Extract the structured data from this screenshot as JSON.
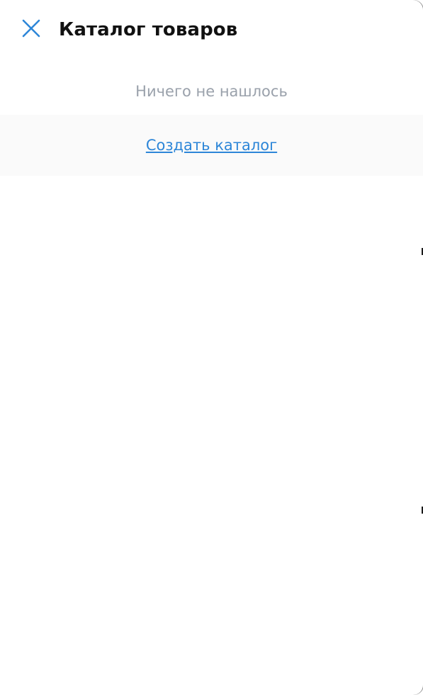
{
  "header": {
    "close_icon": "close-icon",
    "title": "Каталог товаров"
  },
  "main": {
    "empty_message": "Ничего не нашлось",
    "create_link": "Создать каталог"
  },
  "colors": {
    "accent": "#2d86d8",
    "muted_text": "#9aa1ab",
    "title_text": "#111111"
  }
}
